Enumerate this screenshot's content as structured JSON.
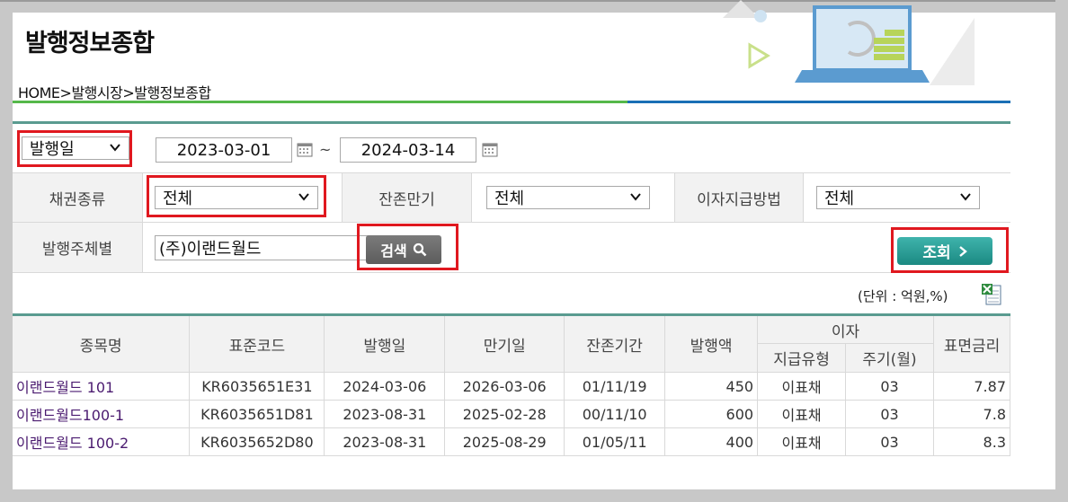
{
  "page": {
    "title": "발행정보종합",
    "breadcrumb": "HOME>발행시장>발행정보종합"
  },
  "search": {
    "date_type": "발행일",
    "date_from": "2023-03-01",
    "date_sep": "~",
    "date_to": "2024-03-14",
    "bond_type_label": "채권종류",
    "bond_type_value": "전체",
    "remaining_label": "잔존만기",
    "remaining_value": "전체",
    "interest_method_label": "이자지급방법",
    "interest_method_value": "전체",
    "issuer_label": "발행주체별",
    "issuer_value": "(주)이랜드월드",
    "search_button": "검색",
    "query_button": "조회"
  },
  "unit_text": "(단위 : 억원,%)",
  "table": {
    "headers": {
      "name": "종목명",
      "code": "표준코드",
      "issue_date": "발행일",
      "maturity": "만기일",
      "remaining": "잔존기간",
      "amount": "발행액",
      "interest": "이자",
      "pay_type": "지급유형",
      "period": "주기(월)",
      "coupon": "표면금리"
    },
    "rows": [
      {
        "name": "이랜드월드 101",
        "code": "KR6035651E31",
        "issue_date": "2024-03-06",
        "maturity": "2026-03-06",
        "remaining": "01/11/19",
        "amount": "450",
        "pay_type": "이표채",
        "period": "03",
        "coupon": "7.87"
      },
      {
        "name": "이랜드월드100-1",
        "code": "KR6035651D81",
        "issue_date": "2023-08-31",
        "maturity": "2025-02-28",
        "remaining": "00/11/10",
        "amount": "600",
        "pay_type": "이표채",
        "period": "03",
        "coupon": "7.8"
      },
      {
        "name": "이랜드월드 100-2",
        "code": "KR6035652D80",
        "issue_date": "2023-08-31",
        "maturity": "2025-08-29",
        "remaining": "01/05/11",
        "amount": "400",
        "pay_type": "이표채",
        "period": "03",
        "coupon": "8.3"
      }
    ]
  },
  "colors": {
    "accent_teal": "#5a9b90",
    "highlight_red": "#e0181f",
    "query_button": "#1b8a82",
    "link_purple": "#4b1b70"
  }
}
